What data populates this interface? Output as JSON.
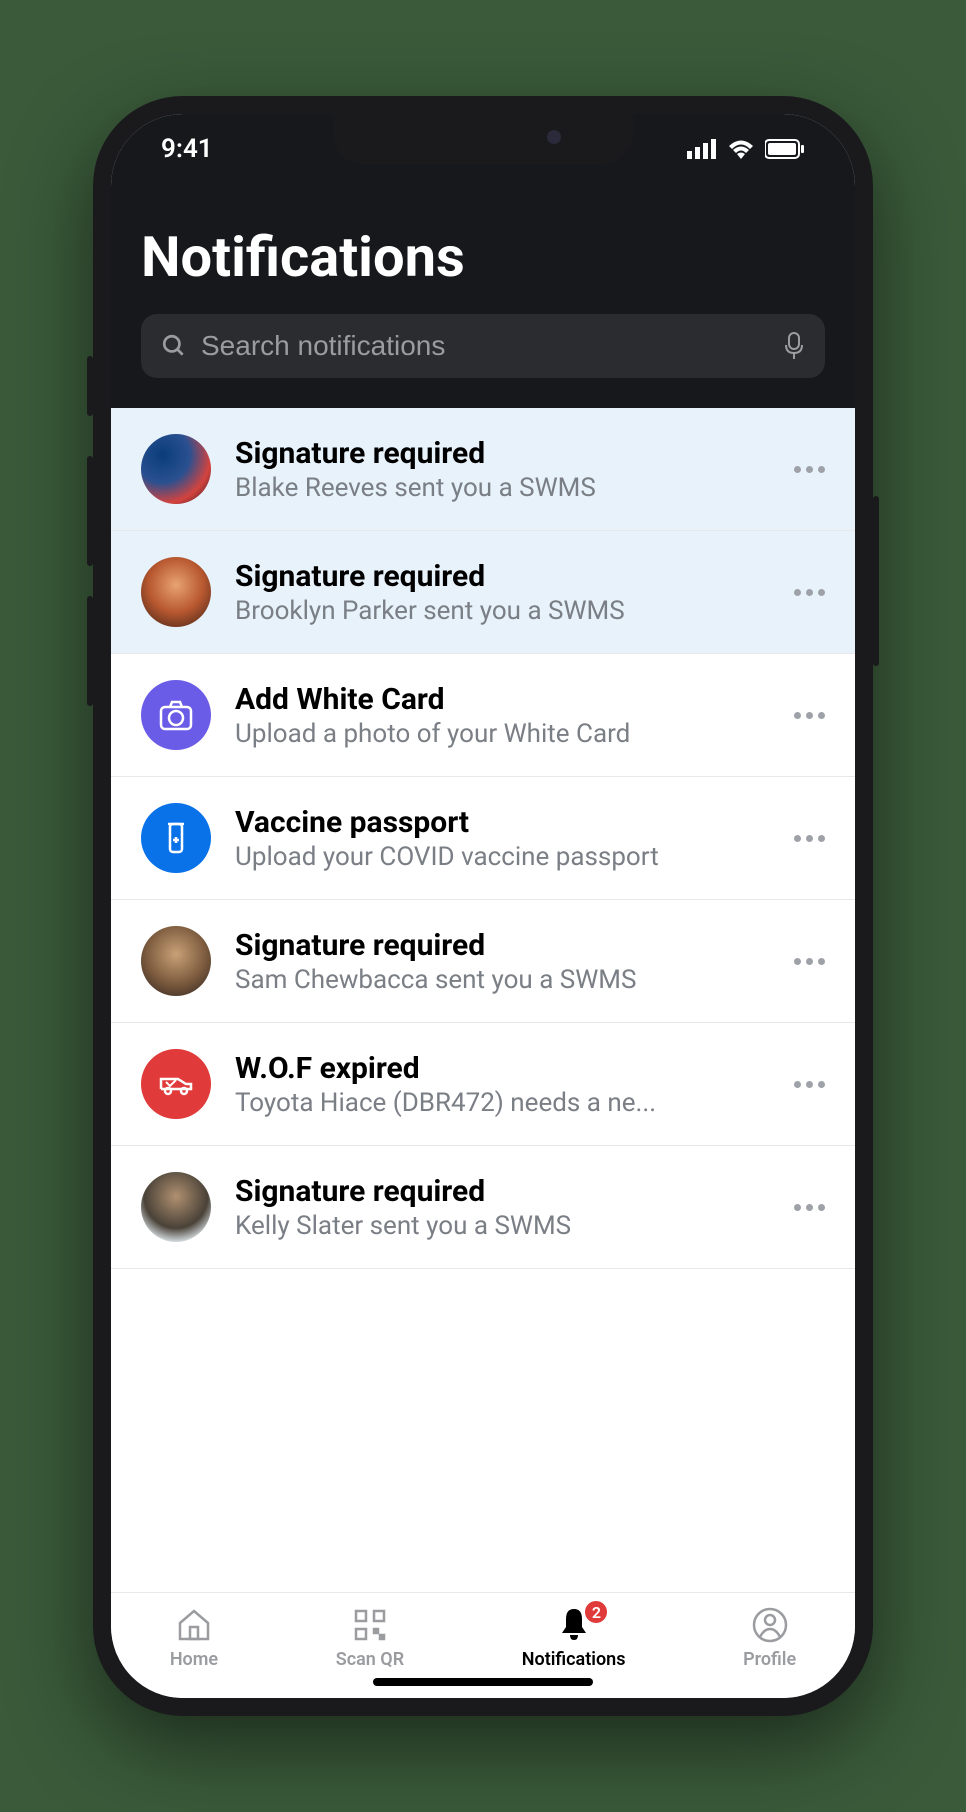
{
  "status": {
    "time": "9:41"
  },
  "header": {
    "title": "Notifications"
  },
  "search": {
    "placeholder": "Search notifications"
  },
  "notifications": [
    {
      "title": "Signature required",
      "subtitle": "Blake Reeves sent you a SWMS",
      "avatar": "photo1",
      "unread": true
    },
    {
      "title": "Signature required",
      "subtitle": "Brooklyn Parker sent you a SWMS",
      "avatar": "photo2",
      "unread": true
    },
    {
      "title": "Add White Card",
      "subtitle": "Upload a photo of your White Card",
      "avatar": "icon-purple",
      "icon": "camera"
    },
    {
      "title": "Vaccine passport",
      "subtitle": "Upload your COVID vaccine passport",
      "avatar": "icon-blue",
      "icon": "vial"
    },
    {
      "title": "Signature required",
      "subtitle": "Sam Chewbacca sent you a SWMS",
      "avatar": "photo3"
    },
    {
      "title": "W.O.F expired",
      "subtitle": "Toyota Hiace (DBR472) needs a ne...",
      "avatar": "icon-red",
      "icon": "van"
    },
    {
      "title": "Signature required",
      "subtitle": "Kelly Slater sent you a SWMS",
      "avatar": "photo4"
    }
  ],
  "tabs": {
    "home": "Home",
    "scan": "Scan QR",
    "notifications": "Notifications",
    "profile": "Profile",
    "badge": "2"
  }
}
